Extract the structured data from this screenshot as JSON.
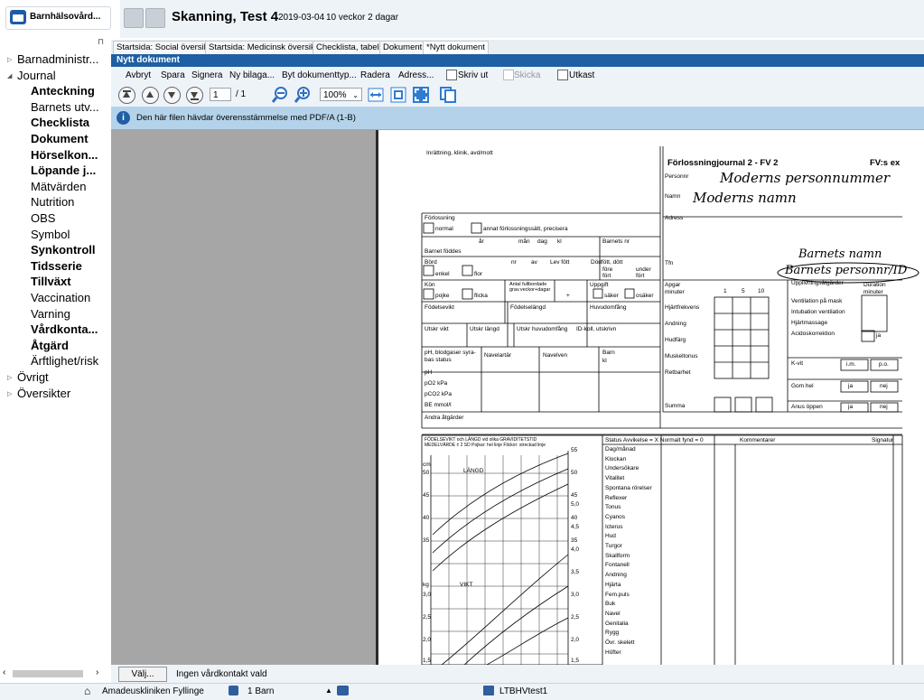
{
  "app": {
    "title": "Barnhälsovård...",
    "icon": "folder-icon"
  },
  "sidebar": {
    "items": [
      {
        "label": "Barnadministr...",
        "level": 1,
        "bold": false,
        "expander": "collapsed"
      },
      {
        "label": "Journal",
        "level": 1,
        "bold": false,
        "expander": "expanded"
      },
      {
        "label": "Anteckning",
        "level": 2,
        "bold": true
      },
      {
        "label": "Barnets utv...",
        "level": 2,
        "bold": false
      },
      {
        "label": "Checklista",
        "level": 2,
        "bold": true
      },
      {
        "label": "Dokument",
        "level": 2,
        "bold": true
      },
      {
        "label": "Hörselkon...",
        "level": 2,
        "bold": true
      },
      {
        "label": "Löpande j...",
        "level": 2,
        "bold": true
      },
      {
        "label": "Mätvärden",
        "level": 2,
        "bold": false
      },
      {
        "label": "Nutrition",
        "level": 2,
        "bold": false
      },
      {
        "label": "OBS",
        "level": 2,
        "bold": false
      },
      {
        "label": "Symbol",
        "level": 2,
        "bold": false
      },
      {
        "label": "Synkontroll",
        "level": 2,
        "bold": true
      },
      {
        "label": "Tidsserie",
        "level": 2,
        "bold": true
      },
      {
        "label": "Tillväxt",
        "level": 2,
        "bold": true
      },
      {
        "label": "Vaccination",
        "level": 2,
        "bold": false
      },
      {
        "label": "Varning",
        "level": 2,
        "bold": false
      },
      {
        "label": "Vårdkonta...",
        "level": 2,
        "bold": true
      },
      {
        "label": "Åtgärd",
        "level": 2,
        "bold": true
      },
      {
        "label": "Ärftlighet/risk",
        "level": 2,
        "bold": false
      },
      {
        "label": "Övrigt",
        "level": 1,
        "bold": false,
        "expander": "collapsed"
      },
      {
        "label": "Översikter",
        "level": 1,
        "bold": false,
        "expander": "collapsed"
      }
    ]
  },
  "header": {
    "patient": "Skanning, Test 4",
    "birthdate": "2019-03-04",
    "age": "10 veckor 2 dagar"
  },
  "tabs": [
    {
      "label": "Startsida: Social översikt",
      "active": false
    },
    {
      "label": "Startsida: Medicinsk översikt",
      "active": false
    },
    {
      "label": "Checklista, tabell",
      "active": false
    },
    {
      "label": "Dokument",
      "active": false
    },
    {
      "label": "*Nytt dokument",
      "active": true
    }
  ],
  "panel": {
    "title": "Nytt dokument"
  },
  "toolbar": {
    "actions": [
      "Avbryt",
      "Spara",
      "Signera",
      "Ny bilaga...",
      "Byt dokumenttyp...",
      "Radera",
      "Adress..."
    ],
    "checkboxes": [
      {
        "label": "Skriv ut",
        "checked": false,
        "enabled": true
      },
      {
        "label": "Skicka",
        "checked": false,
        "enabled": false
      },
      {
        "label": "Utkast",
        "checked": false,
        "enabled": true
      }
    ],
    "page_current": "1",
    "page_total": "/ 1",
    "zoom": "100%"
  },
  "info": {
    "text": "Den här filen hävdar överensstämmelse med PDF/A (1-B)"
  },
  "bottom": {
    "choose_button": "Välj...",
    "contact_text": "Ingen vårdkontakt vald"
  },
  "status": {
    "clinic": "Amadeuskliniken Fyllinge",
    "children": "1 Barn",
    "user": "LTBHVtest1"
  },
  "document": {
    "institution": "Inrättning, klinik, avd/mott",
    "title": "Förlossningjournal 2 - FV 2",
    "code": "FV:s ex",
    "personnr_label": "Personnr",
    "namn_label": "Namn",
    "adress_label": "Adress",
    "tfn_label": "Tfn",
    "hand_mother_pnr": "Moderns personnummer",
    "hand_mother_name": "Moderns namn",
    "hand_child_name": "Barnets namn",
    "hand_child_pnr": "Barnets personnr/ID",
    "left_labels": [
      "Förlossning",
      "normal",
      "annat förlossningssätt, precisera",
      "Barnet föddes",
      "år",
      "mån",
      "dag",
      "kl",
      "Barnets nr",
      "Börd",
      "enkel",
      "flor",
      "nr",
      "av",
      "Lev fött",
      "Dödfött, dött",
      "före",
      "fört",
      "under",
      "fört",
      "Kön",
      "pojke",
      "flicka",
      "Antal fullbordade grav.veckor+dagar",
      "+",
      "Uppgift",
      "säker",
      "osäker",
      "Födelsevikt",
      "Födelselängd",
      "Huvudomfång",
      "Utskr vikt",
      "Utskr längd",
      "Utskr huvudomfång",
      "ID-koll, utskrivn",
      "pH, blodgaser syra-bas status",
      "Navelartär",
      "Navelven",
      "Barn",
      "kl",
      "pH",
      "pO2 kPa",
      "pCO2 kPa",
      "BE mmol/l",
      "Andra åtgärder"
    ],
    "apgar_labels": [
      "Apgar minuter",
      "1",
      "5",
      "10",
      "Hjärtfrekvens",
      "Andning",
      "Hudfärg",
      "Muskeltonus",
      "Retbarhet",
      "Summa"
    ],
    "right_labels": [
      "Upplivningsåtgärder",
      "Duration minuter",
      "Ventilation på mask",
      "Intubation ventilation",
      "Hjärtmassage",
      "Acidoskorrektion",
      "ja",
      "K-vit",
      "i.m.",
      "p.o.",
      "Gom hel",
      "ja",
      "nej",
      "Anus öppen",
      "ja",
      "nej"
    ],
    "chart_header": "FÖDELSEVIKT och LÄNGD vid olika GRAVIDITETSTID MEDELVÄRDE ± 2 SD Pojkar: hel linje Flickor: streckad linje",
    "chart_labels": [
      "cm",
      "LÄNGD",
      "VIKT",
      "kg"
    ],
    "chart_left_ticks": [
      "50",
      "45",
      "40",
      "35",
      "3,0",
      "2,5",
      "2,0",
      "1,5"
    ],
    "chart_right_ticks": [
      "55",
      "50",
      "45",
      "40",
      "35",
      "5,0",
      "4,5",
      "4,0",
      "3,5",
      "3,0",
      "2,5",
      "2,0",
      "1,5"
    ],
    "status_header": "Status Avvikelse = X Normalt fynd = 0",
    "status_comments": "Kommentarer",
    "status_signature": "Signatur",
    "status_items": [
      "Dag/månad",
      "Klockan",
      "Undersökare",
      "Vitalitet",
      "Spontana rörelser",
      "Reflexer",
      "Tonus",
      "Cyanos",
      "Icterus",
      "Hud",
      "Turgor",
      "Skallform",
      "Fontanell",
      "Andning",
      "Hjärta",
      "Fem.puls",
      "Buk",
      "Navel",
      "Genitalia",
      "Rygg",
      "Övr. skelett",
      "Höfter"
    ]
  }
}
